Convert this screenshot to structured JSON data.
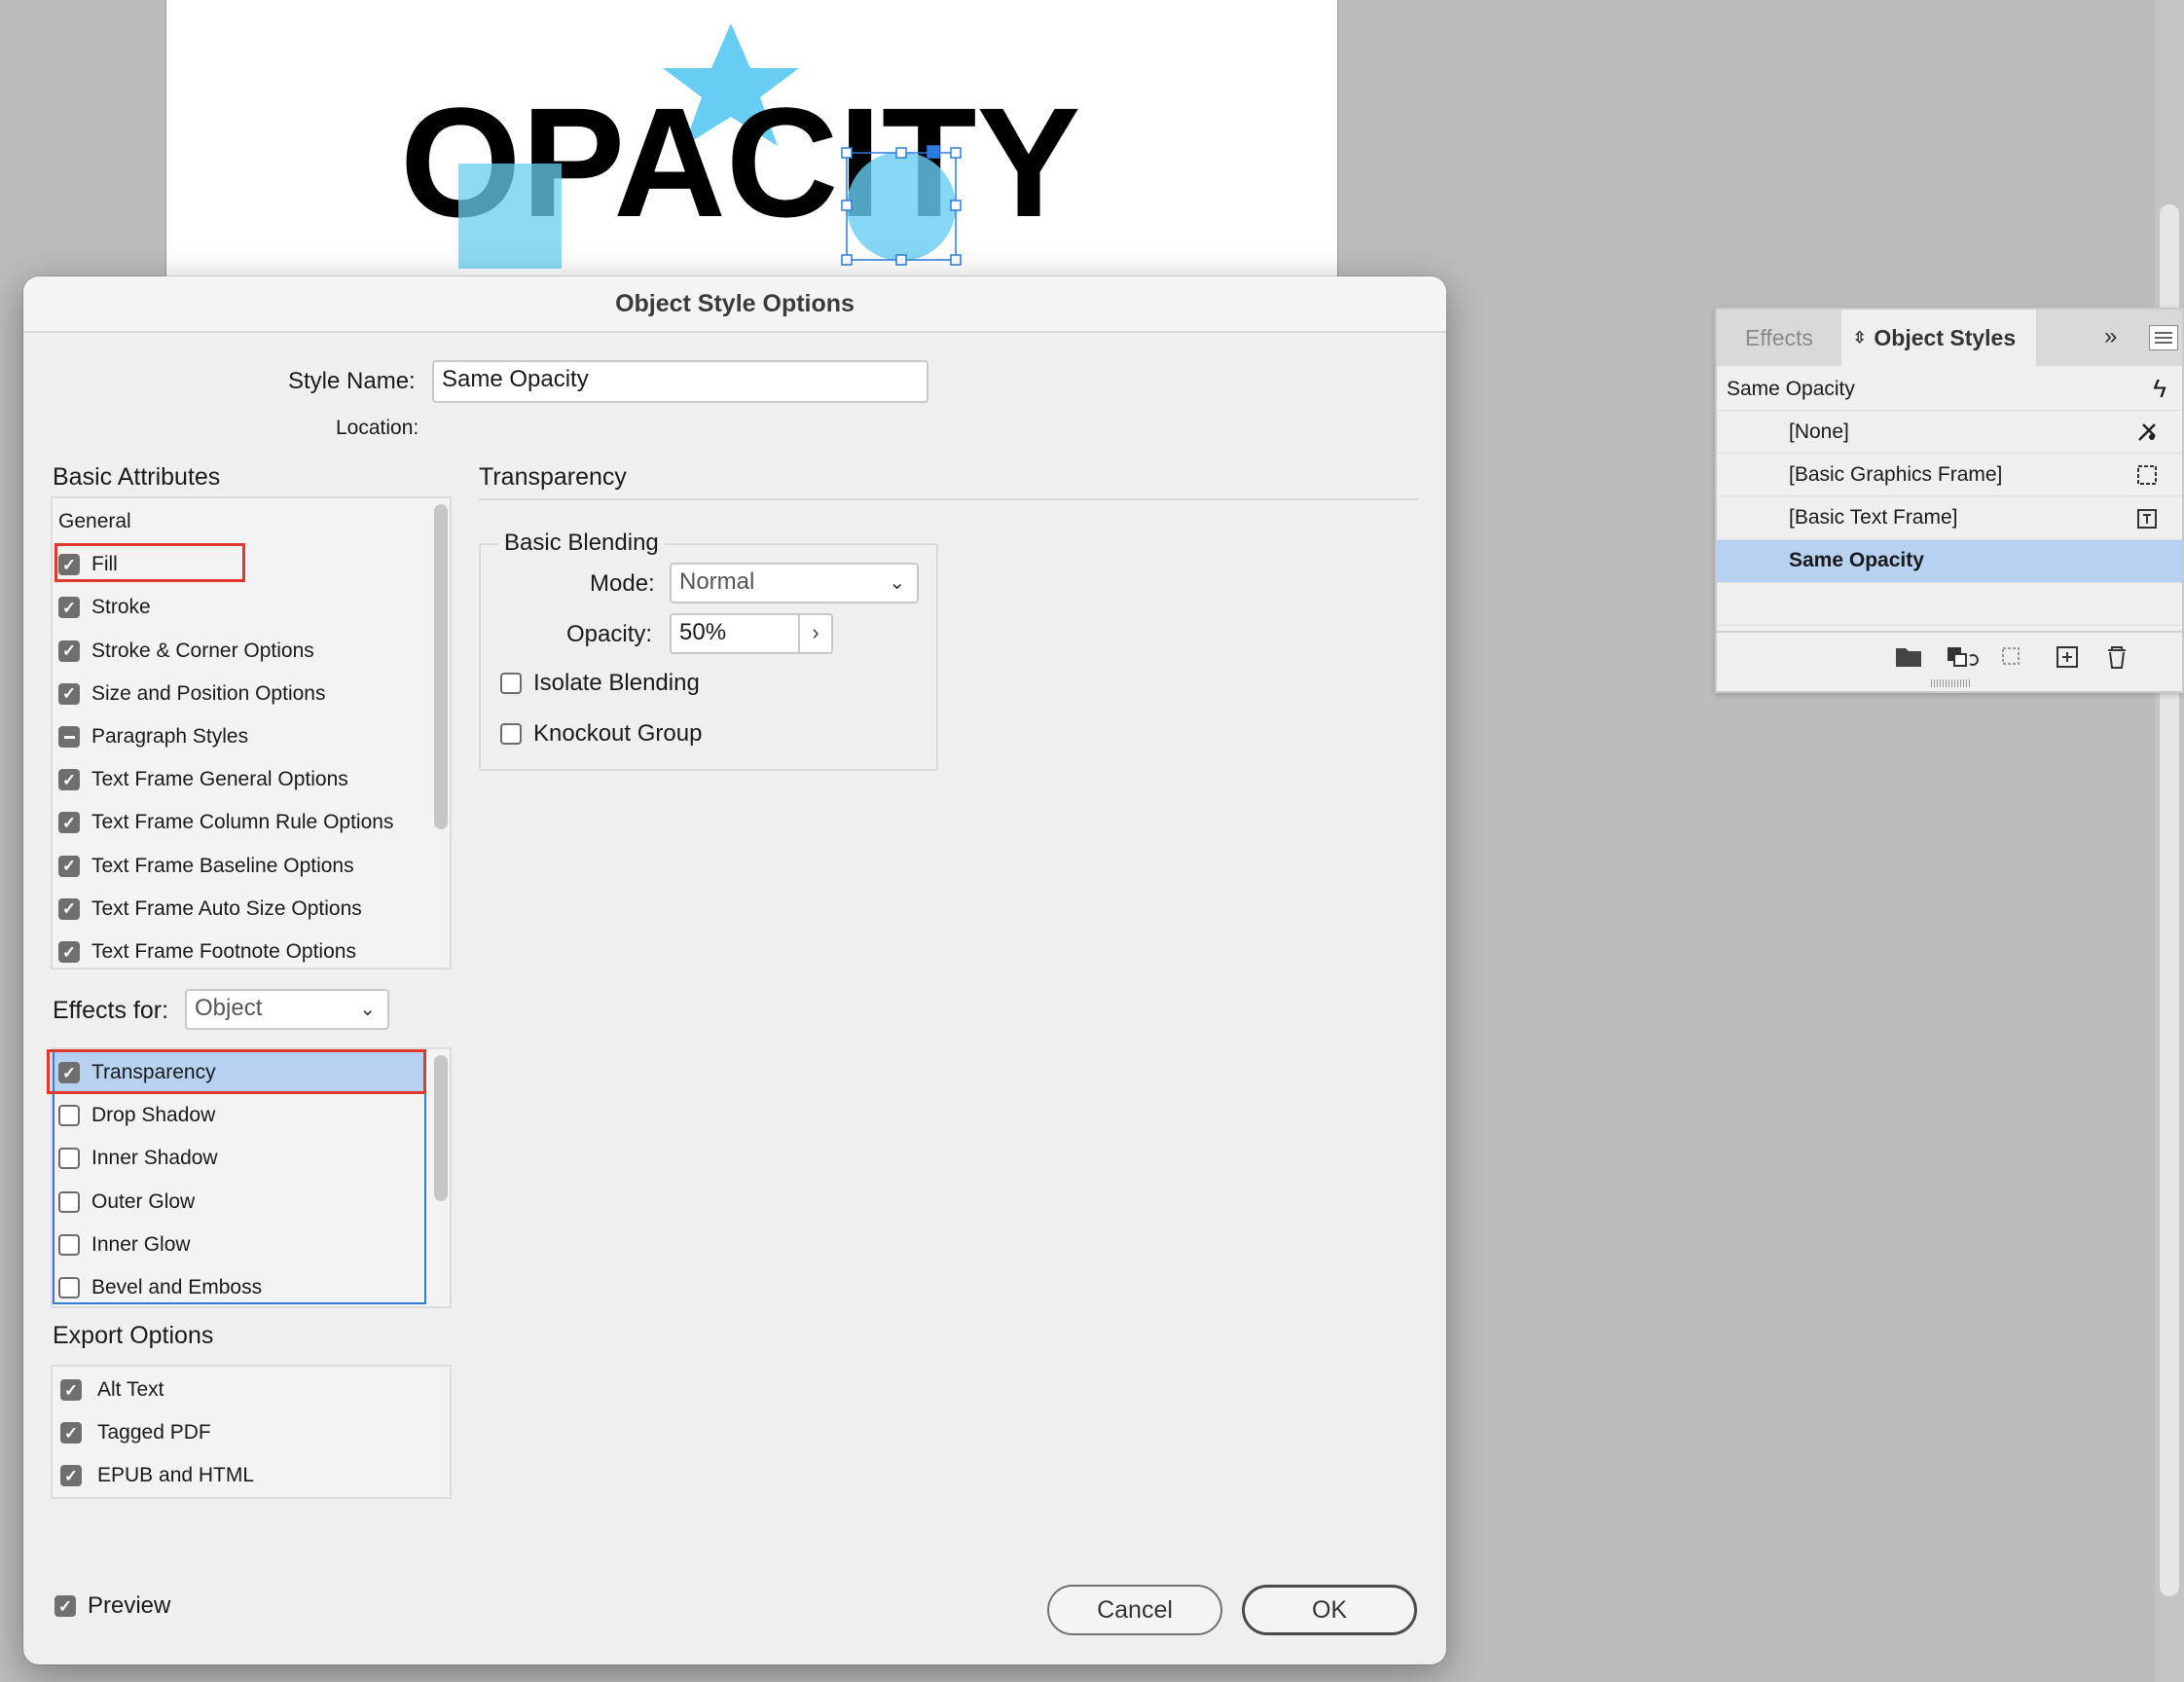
{
  "canvas": {
    "artwork_text": "OPACITY",
    "colors": {
      "shape_blue": "#67cdf2",
      "text_black": "#000000",
      "selection": "#2b7be0"
    }
  },
  "dialog": {
    "title": "Object Style Options",
    "style_name_label": "Style Name:",
    "style_name_value": "Same Opacity",
    "location_label": "Location:",
    "basic_attributes": {
      "title": "Basic Attributes",
      "items": [
        {
          "label": "General",
          "state": "none"
        },
        {
          "label": "Fill",
          "state": "on"
        },
        {
          "label": "Stroke",
          "state": "on"
        },
        {
          "label": "Stroke & Corner Options",
          "state": "on"
        },
        {
          "label": "Size and Position Options",
          "state": "on"
        },
        {
          "label": "Paragraph Styles",
          "state": "mixed"
        },
        {
          "label": "Text Frame General Options",
          "state": "on"
        },
        {
          "label": "Text Frame Column Rule Options",
          "state": "on"
        },
        {
          "label": "Text Frame Baseline Options",
          "state": "on"
        },
        {
          "label": "Text Frame Auto Size Options",
          "state": "on"
        },
        {
          "label": "Text Frame Footnote Options",
          "state": "on"
        }
      ]
    },
    "effects_for": {
      "label": "Effects for:",
      "value": "Object"
    },
    "effects": {
      "items": [
        {
          "label": "Transparency",
          "state": "on",
          "selected": true
        },
        {
          "label": "Drop Shadow",
          "state": "off"
        },
        {
          "label": "Inner Shadow",
          "state": "off"
        },
        {
          "label": "Outer Glow",
          "state": "off"
        },
        {
          "label": "Inner Glow",
          "state": "off"
        },
        {
          "label": "Bevel and Emboss",
          "state": "off"
        }
      ]
    },
    "export_options": {
      "title": "Export Options",
      "items": [
        {
          "label": "Alt Text",
          "state": "on"
        },
        {
          "label": "Tagged PDF",
          "state": "on"
        },
        {
          "label": "EPUB and HTML",
          "state": "on"
        }
      ]
    },
    "transparency": {
      "title": "Transparency",
      "basic_blending": "Basic Blending",
      "mode_label": "Mode:",
      "mode_value": "Normal",
      "opacity_label": "Opacity:",
      "opacity_value": "50%",
      "isolate_blending": "Isolate Blending",
      "knockout_group": "Knockout Group"
    },
    "preview_label": "Preview",
    "cancel_label": "Cancel",
    "ok_label": "OK"
  },
  "panel": {
    "tab_effects": "Effects",
    "tab_object_styles": "Object Styles",
    "current_style": "Same Opacity",
    "styles": [
      {
        "label": "[None]",
        "icon": "no-style-icon"
      },
      {
        "label": "[Basic Graphics Frame]",
        "icon": "graphics-frame-icon"
      },
      {
        "label": "[Basic Text Frame]",
        "icon": "text-frame-icon"
      },
      {
        "label": "Same Opacity",
        "icon": "",
        "selected": true
      }
    ],
    "selection_color": "#b6d2f0"
  }
}
